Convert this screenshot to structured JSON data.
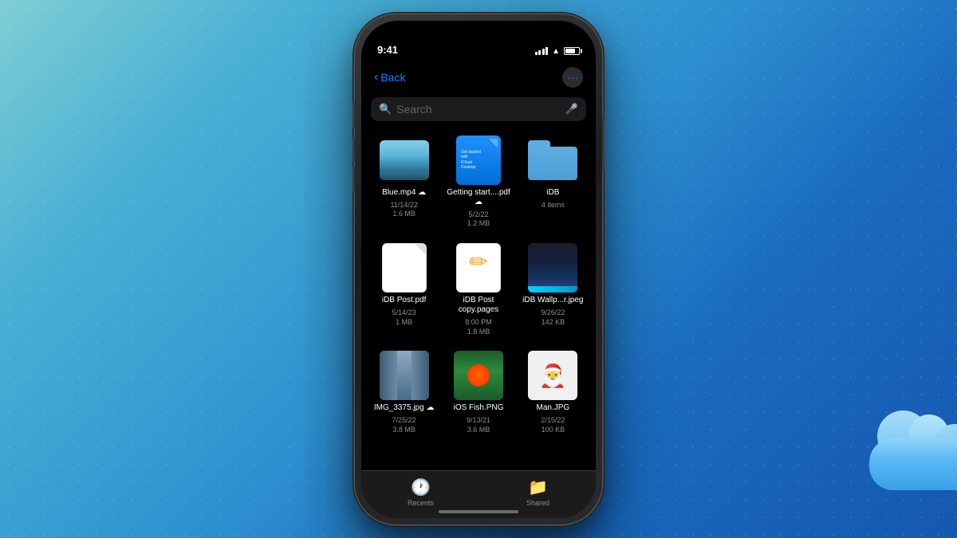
{
  "background": {
    "gradient_start": "#7ecfd4",
    "gradient_end": "#1558b0"
  },
  "status_bar": {
    "time": "9:41",
    "signal_label": "signal",
    "wifi_label": "wifi",
    "battery_label": "battery"
  },
  "nav": {
    "back_label": "Back",
    "more_label": "..."
  },
  "search": {
    "placeholder": "Search"
  },
  "files": [
    {
      "name": "Blue.mp4",
      "type": "video",
      "date": "11/14/22",
      "size": "1.6 MB",
      "cloud": true
    },
    {
      "name": "Getting start....pdf",
      "type": "doc-blue",
      "date": "5/2/22",
      "size": "1.2 MB",
      "cloud": true
    },
    {
      "name": "iDB",
      "type": "folder",
      "date": "",
      "size": "4 items",
      "cloud": false
    },
    {
      "name": "iDB Post.pdf",
      "type": "pdf",
      "date": "5/14/23",
      "size": "1 MB",
      "cloud": false
    },
    {
      "name": "iDB Post copy.pages",
      "type": "pages",
      "date": "8:00 PM",
      "size": "1.8 MB",
      "cloud": false
    },
    {
      "name": "iDB Wallp...r.jpeg",
      "type": "wallpaper",
      "date": "9/26/22",
      "size": "142 KB",
      "cloud": false
    },
    {
      "name": "IMG_3375.jpg",
      "type": "curtains",
      "date": "7/25/22",
      "size": "3.8 MB",
      "cloud": true
    },
    {
      "name": "iOS Fish.PNG",
      "type": "fish",
      "date": "9/13/21",
      "size": "3.6 MB",
      "cloud": false
    },
    {
      "name": "Man.JPG",
      "type": "man",
      "date": "2/15/22",
      "size": "100 KB",
      "cloud": false
    }
  ],
  "tabs": [
    {
      "label": "Recents",
      "icon": "🕐"
    },
    {
      "label": "Shared",
      "icon": "📁"
    }
  ]
}
